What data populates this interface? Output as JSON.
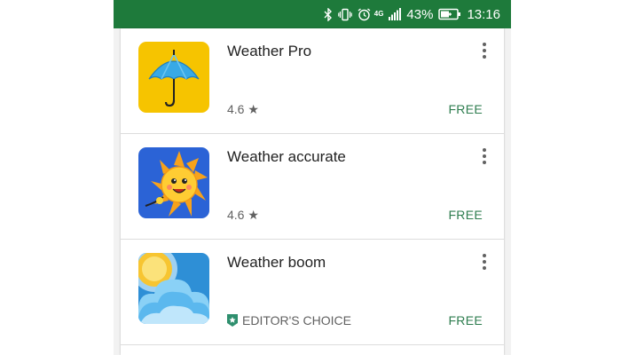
{
  "status_bar": {
    "bg_color": "#1e7a3b",
    "icons": [
      "bluetooth-icon",
      "vibrate-icon",
      "alarm-icon",
      "signal-icon",
      "battery-charging-icon"
    ],
    "network": "4G",
    "battery_text": "43%",
    "time": "13:16"
  },
  "apps": [
    {
      "name": "Weather Pro",
      "rating": "4.6",
      "price": "FREE",
      "icon": "umbrella-icon",
      "icon_bg": "#f6c400"
    },
    {
      "name": "Weather accurate",
      "rating": "4.6",
      "price": "FREE",
      "icon": "sun-face-icon",
      "icon_bg": "#2b63d6"
    },
    {
      "name": "Weather boom",
      "badge_label": "EDITOR'S CHOICE",
      "price": "FREE",
      "icon": "cloud-sun-icon",
      "icon_bg": "#2e8fd6"
    }
  ],
  "colors": {
    "price": "#2e7d4f",
    "accent": "#1e7a3b"
  }
}
